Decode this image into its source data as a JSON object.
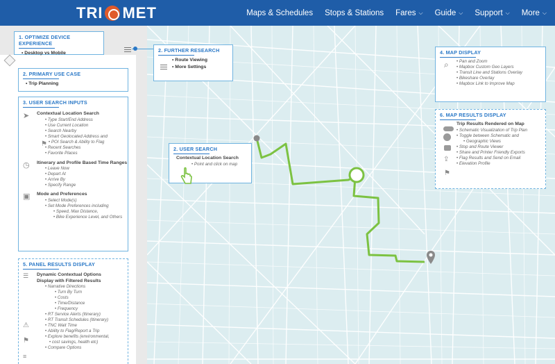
{
  "header": {
    "logo_left": "TRI",
    "logo_right": "MET",
    "nav": [
      {
        "label": "Maps & Schedules",
        "chevron": false
      },
      {
        "label": "Stops & Stations",
        "chevron": false
      },
      {
        "label": "Fares",
        "chevron": true
      },
      {
        "label": "Guide",
        "chevron": true
      },
      {
        "label": "Support",
        "chevron": true
      },
      {
        "label": "More",
        "chevron": true
      }
    ]
  },
  "boxes": {
    "optimize": {
      "title": "1. Optimize Device Experience",
      "items": [
        "Desktop vs Mobile"
      ]
    },
    "primary": {
      "title": "2. Primary Use Case",
      "items": [
        "Trip Planning"
      ]
    },
    "further": {
      "title": "2. Further Research",
      "items": [
        "Route Viewing",
        "More Settings"
      ]
    },
    "user_search": {
      "title": "2. User Search",
      "heading": "Contextual Location Search",
      "items": [
        "Point and click on map"
      ]
    },
    "inputs": {
      "title": "3. User Search Inputs",
      "sections": [
        {
          "heading": "Contextual Location Search",
          "items": [
            "Type Start/End Address",
            "Use Current Location",
            "Search Nearby",
            "Smart Geolocated Address and",
            "POI Search & Ability to Flag",
            "Recent Searches",
            "Favorite Places"
          ]
        },
        {
          "heading": "Itinerary and Profile Based Time Ranges",
          "items": [
            "Leave Now",
            "Depart At",
            "Arrive By",
            "Specify Range"
          ]
        },
        {
          "heading": "Mode and Preferences",
          "items": [
            "Select Mode(s)",
            "Set Mode Preferences including",
            "Speed, Max Distance,",
            "Bike Experience Level, and Others"
          ]
        }
      ]
    },
    "panel_results": {
      "title": "5. Panel Results Display",
      "heading": "Dynamic Contextual Options Display with Filtered Results",
      "items": [
        "Narrative Directions"
      ],
      "deep": [
        "Turn By Turn",
        "Costs",
        "Time/Distance",
        "Frequency"
      ],
      "more": [
        "RT Service Alerts (Itinerary)",
        "RT Transit Schedules (Itinerary)",
        "TNC Wait Time",
        "Ability to Flag/Report a Trip",
        "Explore benefits (environmental,",
        "cost savings, health etc)",
        "Compare Options"
      ]
    },
    "map_display": {
      "title": "4. Map Display",
      "items": [
        "Pan and Zoom",
        "Mapbox Custom Geo Layers",
        "Transit Line and Stations Overlay",
        "Bikeshare Overlay",
        "Mapbox Link to Improve Map"
      ]
    },
    "map_results": {
      "title": "6. Map Results Display",
      "heading": "Trip Results Rendered on Map",
      "items": [
        "Schematic Visualization of Trip Plan",
        "Toggle between Schematic and",
        "Geographic Views",
        "Stop and Route Viewer",
        "Share and Printer Friendly Exports",
        "Flag Results and Send on Email",
        "Elevation Profile"
      ]
    }
  },
  "colors": {
    "header": "#1f5da8",
    "accent": "#2a78c7",
    "route": "#7cc242",
    "map_bg": "#dcedf0"
  }
}
